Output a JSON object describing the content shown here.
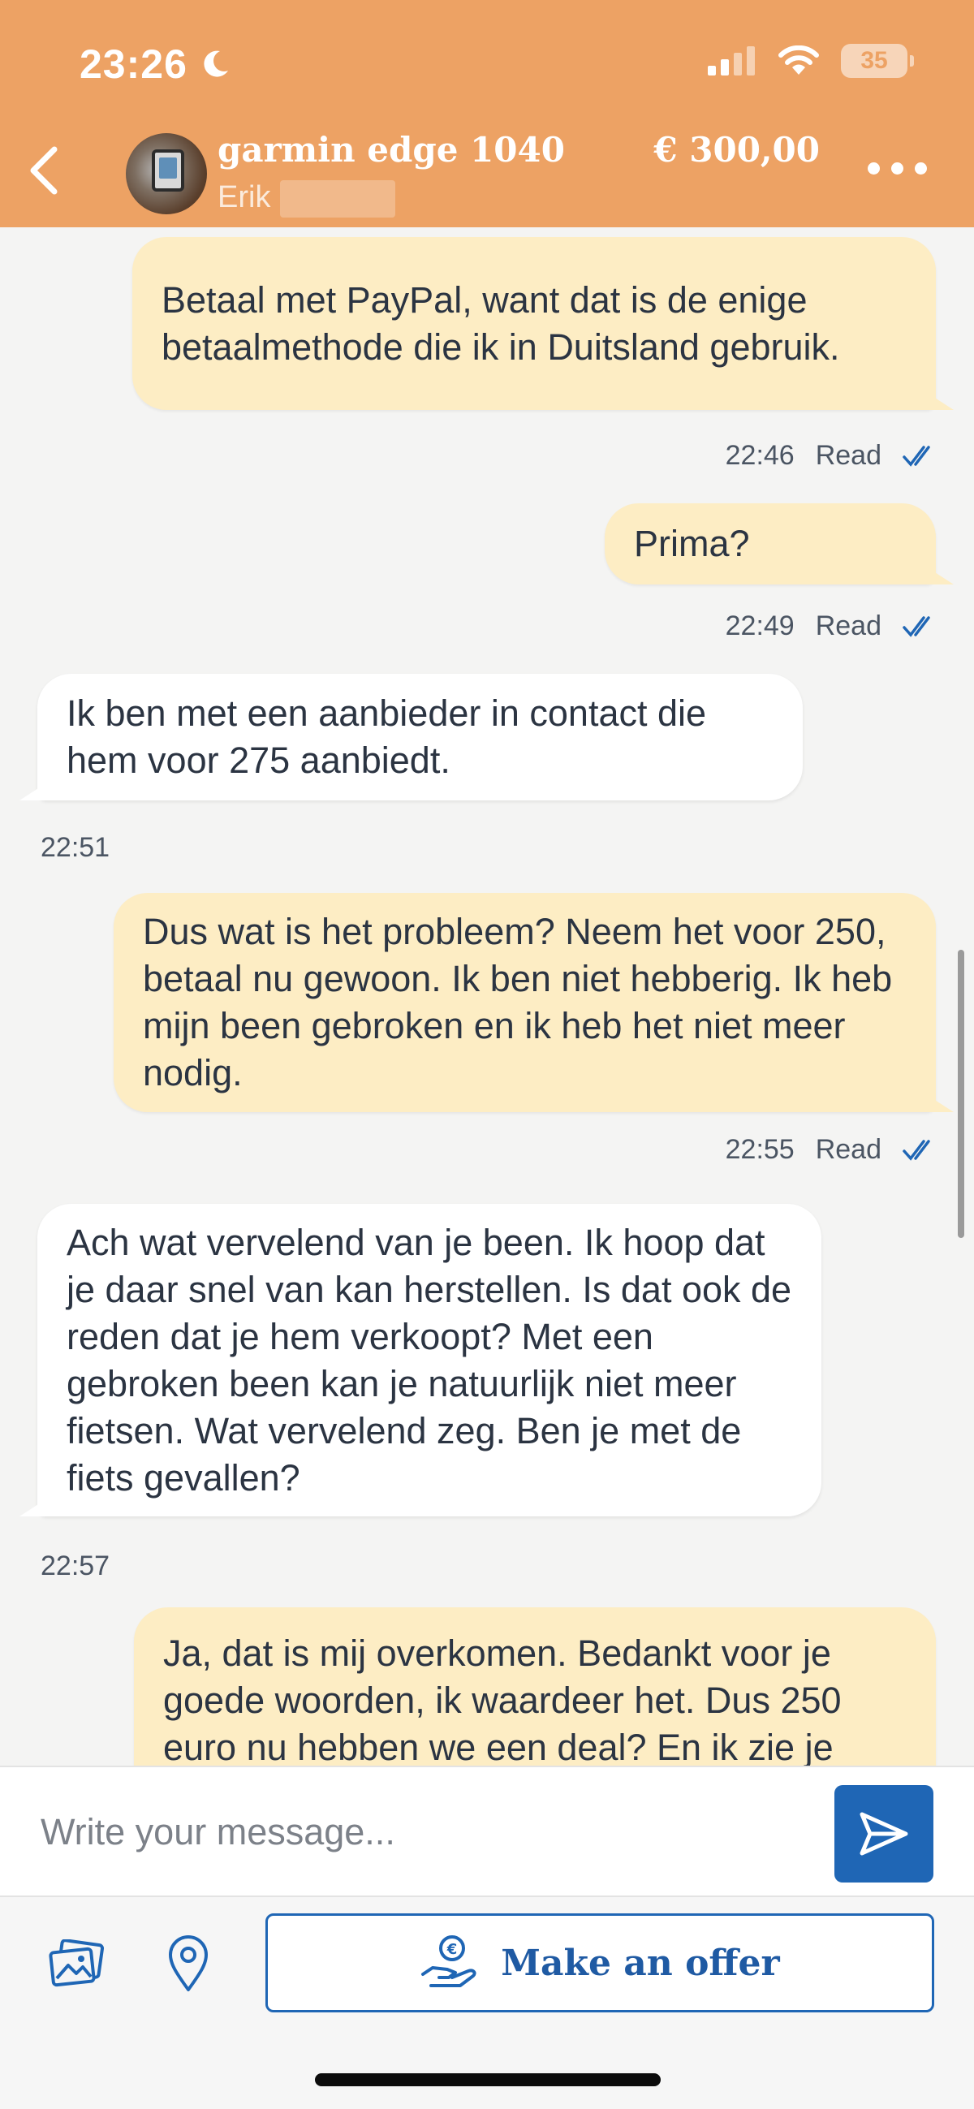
{
  "status_bar": {
    "time": "23:26",
    "battery": "35"
  },
  "header": {
    "listing_title": "garmin edge 1040",
    "seller_name": "Erik",
    "price": "€ 300,00"
  },
  "messages": [
    {
      "direction": "out",
      "text": "Betaal met PayPal, want dat is de enige betaalmethode die ik in Duitsland gebruik.",
      "time": "22:46",
      "status": "Read"
    },
    {
      "direction": "out",
      "text": "Prima?",
      "time": "22:49",
      "status": "Read"
    },
    {
      "direction": "in",
      "text": "Ik ben met een aanbieder in contact die hem voor 275 aanbiedt.",
      "time": "22:51"
    },
    {
      "direction": "out",
      "text": "Dus wat is het probleem? Neem het voor 250, betaal nu gewoon. Ik ben niet hebberig. Ik heb mijn been gebroken en ik heb het niet meer nodig.",
      "time": "22:55",
      "status": "Read"
    },
    {
      "direction": "in",
      "text": "Ach wat vervelend van je been. Ik hoop dat je daar snel van kan herstellen. Is dat ook de reden dat je hem verkoopt? Met een gebroken been kan je natuurlijk niet meer fietsen. Wat vervelend zeg. Ben je met de fiets gevallen?",
      "time": "22:57"
    },
    {
      "direction": "out",
      "text": "Ja, dat is mij overkomen. Bedankt voor je goede woorden, ik waardeer het. Dus 250 euro nu hebben we een deal? En ik zie je"
    }
  ],
  "composer": {
    "placeholder": "Write your message..."
  },
  "actions": {
    "offer_label": "Make an offer"
  },
  "colors": {
    "header_bg": "#eda264",
    "outgoing_bubble": "#fdedc4",
    "incoming_bubble": "#ffffff",
    "accent_blue": "#1f66b5"
  }
}
